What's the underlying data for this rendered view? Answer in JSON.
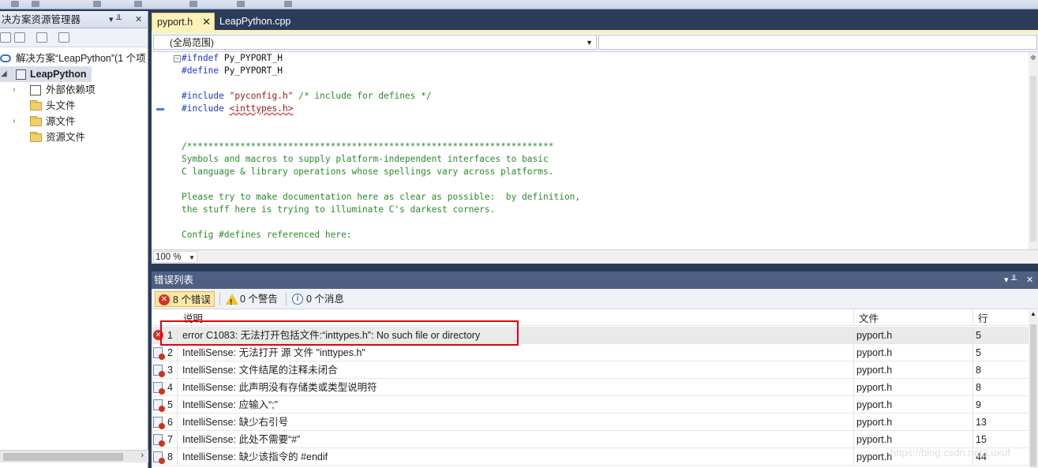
{
  "solution_explorer": {
    "title": "决方案资源管理器",
    "pin": "▾ ╨",
    "close": "✕",
    "solution_label": "解决方案“LeapPython”(1 个项",
    "project_label": "LeapPython",
    "items": [
      {
        "label": "外部依赖项",
        "expandable": true
      },
      {
        "label": "头文件",
        "expandable": false
      },
      {
        "label": "源文件",
        "expandable": true
      },
      {
        "label": "资源文件",
        "expandable": false
      }
    ]
  },
  "editor": {
    "tabs": [
      {
        "label": "pyport.h",
        "active": true,
        "close": "✕"
      },
      {
        "label": "LeapPython.cpp",
        "active": false
      }
    ],
    "scope": "(全局范围)",
    "zoom": "100 %",
    "code_lines": [
      {
        "parts": [
          [
            "kw",
            "#ifndef"
          ],
          [
            "plain",
            " Py_PYPORT_H"
          ]
        ]
      },
      {
        "parts": [
          [
            "kw",
            "#define"
          ],
          [
            "plain",
            " Py_PYPORT_H"
          ]
        ]
      },
      {
        "parts": []
      },
      {
        "parts": [
          [
            "kw",
            "#include"
          ],
          [
            "plain",
            " "
          ],
          [
            "str",
            "\"pyconfig.h\""
          ],
          [
            "plain",
            " "
          ],
          [
            "cmt",
            "/* include for defines */"
          ]
        ]
      },
      {
        "parts": [
          [
            "kw",
            "#include"
          ],
          [
            "plain",
            " "
          ],
          [
            "str",
            "<inttypes.h>"
          ]
        ]
      },
      {
        "parts": []
      },
      {
        "parts": []
      },
      {
        "parts": [
          [
            "cmt",
            "/*********************************************************************"
          ]
        ]
      },
      {
        "parts": [
          [
            "cmt",
            "Symbols and macros to supply platform-independent interfaces to basic"
          ]
        ]
      },
      {
        "parts": [
          [
            "cmt",
            "C language & library operations whose spellings vary across platforms."
          ]
        ]
      },
      {
        "parts": []
      },
      {
        "parts": [
          [
            "cmt",
            "Please try to make documentation here as clear as possible:  by definition,"
          ]
        ]
      },
      {
        "parts": [
          [
            "cmt",
            "the stuff here is trying to illuminate C's darkest corners."
          ]
        ]
      },
      {
        "parts": []
      },
      {
        "parts": [
          [
            "cmt",
            "Config #defines referenced here:"
          ]
        ]
      }
    ]
  },
  "error_list": {
    "title": "错误列表",
    "pin": "▾ ╨",
    "close": "✕",
    "filters": {
      "errors": "8 个错误",
      "warnings": "0 个警告",
      "messages": "0 个消息"
    },
    "columns": {
      "description": "说明",
      "file": "文件",
      "line": "行"
    },
    "rows": [
      {
        "num": "1",
        "description": "error C1083: 无法打开包括文件:“inttypes.h”: No such file or directory",
        "file": "pyport.h",
        "line": "5",
        "kind": "error"
      },
      {
        "num": "2",
        "description": "IntelliSense: 无法打开 源 文件 \"inttypes.h\"",
        "file": "pyport.h",
        "line": "5",
        "kind": "intellisense"
      },
      {
        "num": "3",
        "description": "IntelliSense: 文件结尾的注释未闭合",
        "file": "pyport.h",
        "line": "8",
        "kind": "intellisense"
      },
      {
        "num": "4",
        "description": "IntelliSense: 此声明没有存储类或类型说明符",
        "file": "pyport.h",
        "line": "8",
        "kind": "intellisense"
      },
      {
        "num": "5",
        "description": "IntelliSense: 应输入“;”",
        "file": "pyport.h",
        "line": "9",
        "kind": "intellisense"
      },
      {
        "num": "6",
        "description": "IntelliSense: 缺少右引号",
        "file": "pyport.h",
        "line": "13",
        "kind": "intellisense"
      },
      {
        "num": "7",
        "description": "IntelliSense: 此处不需要“#”",
        "file": "pyport.h",
        "line": "15",
        "kind": "intellisense"
      },
      {
        "num": "8",
        "description": "IntelliSense: 缺少该指令的 #endif",
        "file": "pyport.h",
        "line": "44",
        "kind": "intellisense"
      }
    ]
  },
  "watermark": "https://blog.csdn.net/Luxuf",
  "colors": {
    "accent_tab": "#fff1b8",
    "error_red": "#d3321f",
    "highlight": "#e3000f",
    "frame": "#2b3c59"
  }
}
